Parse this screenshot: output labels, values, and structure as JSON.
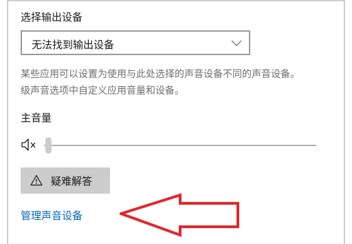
{
  "output_device": {
    "section_title": "选择输出设备",
    "selected_value": "无法找到输出设备",
    "dropdown_icon": "chevron-down-icon"
  },
  "description": {
    "line1": "某些应用可以设置为使用与此处选择的声音设备不同的声音设备。",
    "line2": "级声音选项中自定义应用音量和设备。"
  },
  "master_volume": {
    "label": "主音量",
    "icon": "speaker-muted-icon",
    "value_percent": 0
  },
  "troubleshoot": {
    "label": "疑难解答",
    "icon": "warning-icon"
  },
  "manage_link": {
    "label": "管理声音设备"
  },
  "colors": {
    "link": "#0067b8",
    "description_text": "#6e6e6e",
    "button_bg": "#cccccc",
    "annotation_arrow": "#e0282e"
  }
}
